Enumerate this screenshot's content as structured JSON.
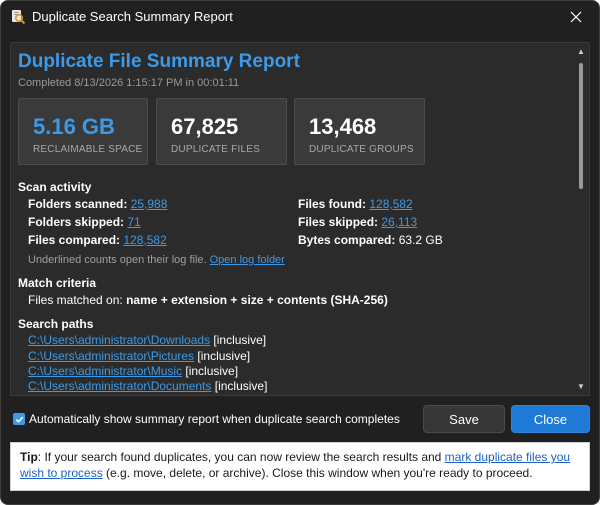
{
  "window": {
    "title": "Duplicate Search Summary Report"
  },
  "report": {
    "title": "Duplicate File Summary Report",
    "completed": "Completed 8/13/2026 1:15:17 PM in 00:01:11",
    "cards": [
      {
        "value": "5.16 GB",
        "label": "RECLAIMABLE SPACE"
      },
      {
        "value": "67,825",
        "label": "DUPLICATE FILES"
      },
      {
        "value": "13,468",
        "label": "DUPLICATE GROUPS"
      }
    ],
    "scan_activity": {
      "heading": "Scan activity",
      "folders_scanned_label": "Folders scanned:",
      "folders_scanned": "25,988",
      "folders_skipped_label": "Folders skipped:",
      "folders_skipped": "71",
      "files_compared_label": "Files compared:",
      "files_compared": "128,582",
      "files_found_label": "Files found:",
      "files_found": "128,582",
      "files_skipped_label": "Files skipped:",
      "files_skipped": "26,113",
      "bytes_compared_label": "Bytes compared:",
      "bytes_compared": "63.2 GB",
      "note": "Underlined counts open their log file.",
      "open_log_link": "Open log folder"
    },
    "match_criteria": {
      "heading": "Match criteria",
      "prefix": "Files matched on:",
      "value": "name + extension + size + contents (SHA-256)"
    },
    "search_paths": {
      "heading": "Search paths",
      "paths": [
        {
          "path": "C:\\Users\\administrator\\Downloads",
          "mode": "[inclusive]"
        },
        {
          "path": "C:\\Users\\administrator\\Pictures",
          "mode": "[inclusive]"
        },
        {
          "path": "C:\\Users\\administrator\\Music",
          "mode": "[inclusive]"
        },
        {
          "path": "C:\\Users\\administrator\\Documents",
          "mode": "[inclusive]"
        }
      ]
    }
  },
  "options": {
    "auto_show_label": "Automatically show summary report when duplicate search completes",
    "auto_show_checked": true
  },
  "buttons": {
    "save": "Save",
    "close": "Close"
  },
  "tip": {
    "label": "Tip",
    "text1": ": If your search found duplicates, you can now review the search results and ",
    "link": "mark duplicate files you wish to process",
    "text2": " (e.g. move, delete, or archive). Close this window when you're ready to proceed."
  },
  "colors": {
    "accent": "#3d9ae8",
    "primary_button": "#1f7ad6",
    "background": "#202020",
    "panel": "#2b2b2b"
  }
}
